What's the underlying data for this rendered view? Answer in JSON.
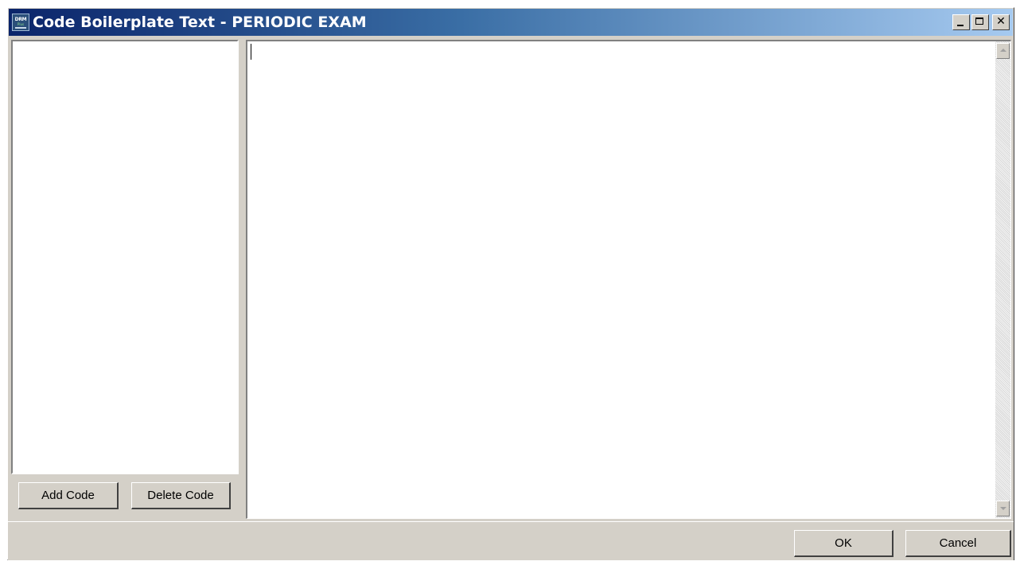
{
  "window": {
    "title": "Code Boilerplate Text - PERIODIC EXAM",
    "icon_name": "drm-app-icon",
    "icon_text_top": "DRM",
    "icon_text_bottom": "Plus"
  },
  "title_bar_buttons": {
    "minimize": "minimize-icon",
    "maximize": "maximize-icon",
    "close": "close-icon"
  },
  "left_panel": {
    "code_list_items": [],
    "add_button_label": "Add Code",
    "delete_button_label": "Delete Code"
  },
  "editor": {
    "text": ""
  },
  "footer": {
    "ok_label": "OK",
    "cancel_label": "Cancel"
  },
  "colors": {
    "title_gradient_start": "#0a246a",
    "title_gradient_end": "#a6caf0",
    "face": "#d4d0c8"
  }
}
